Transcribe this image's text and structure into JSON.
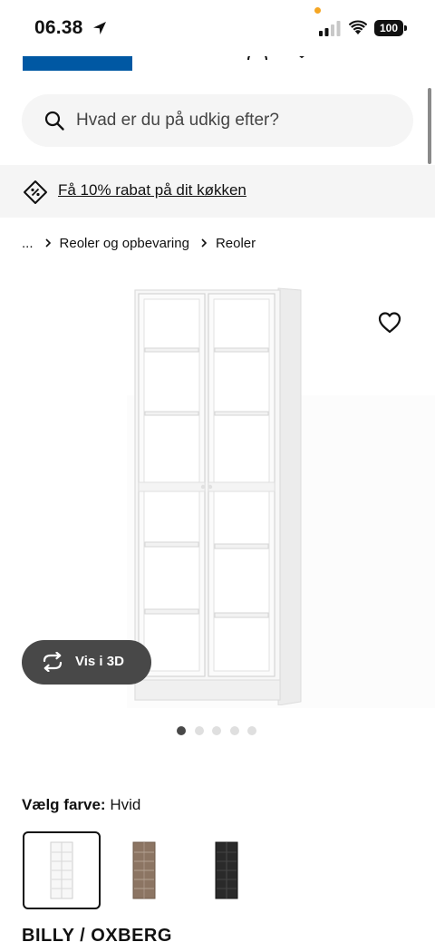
{
  "status_bar": {
    "time": "06.38",
    "battery": "100"
  },
  "header": {
    "logo_name": "ikea-logo",
    "icons": [
      "account-icon",
      "heart-icon",
      "shopping-bag-icon",
      "menu-icon"
    ]
  },
  "search": {
    "placeholder": "Hvad er du på udkig efter?"
  },
  "promo": {
    "text": "Få 10% rabat på dit køkken"
  },
  "breadcrumb": {
    "items": [
      "...",
      "Reoler og opbevaring",
      "Reoler"
    ]
  },
  "gallery": {
    "view3d_label": "Vis i 3D",
    "image_count": 5,
    "active_index": 0
  },
  "colour": {
    "label": "Vælg farve:",
    "value": "Hvid",
    "options": [
      {
        "name": "white",
        "hex": "#f7f7f7"
      },
      {
        "name": "brown-ash",
        "hex": "#8c7563"
      },
      {
        "name": "black-brown",
        "hex": "#2a2a2a"
      }
    ]
  },
  "product": {
    "name": "BILLY / OXBERG"
  },
  "colors": {
    "ikea_blue": "#0058a3",
    "ikea_yellow": "#ffdb00",
    "pill_dark": "#484848",
    "surface_grey": "#f5f5f5"
  }
}
